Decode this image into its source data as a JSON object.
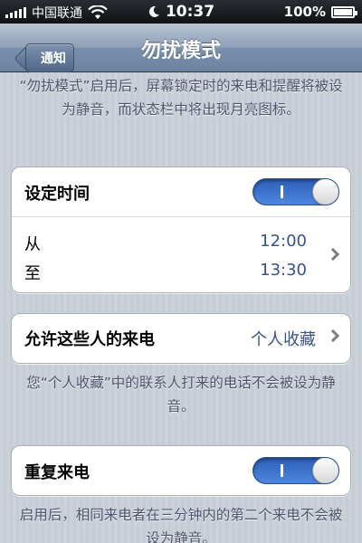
{
  "status_bar": {
    "carrier": "中国联通",
    "time": "10:37",
    "battery": "100%",
    "battery_level": 1.0
  },
  "nav": {
    "back_label": "通知",
    "title": "勿扰模式"
  },
  "intro_note": "“勿扰模式”启用后，屏幕锁定时的来电和提醒将被设为静音，而状态栏中将出现月亮图标。",
  "schedule": {
    "label": "设定时间",
    "toggle_on": true,
    "from_label": "从",
    "from_value": "12:00",
    "to_label": "至",
    "to_value": "13:30"
  },
  "allow_calls": {
    "label": "允许这些人的来电",
    "value": "个人收藏"
  },
  "allow_calls_note": "您“个人收藏”中的联系人打来的电话不会被设为静音。",
  "repeat_calls": {
    "label": "重复来电",
    "toggle_on": true
  },
  "repeat_calls_note": "启用后，相同来电者在三分钟内的第二个来电不会被设为静音。",
  "colors": {
    "accent": "#385487",
    "toggle_on": "#3b73d1",
    "background": "#c5ccd4"
  }
}
